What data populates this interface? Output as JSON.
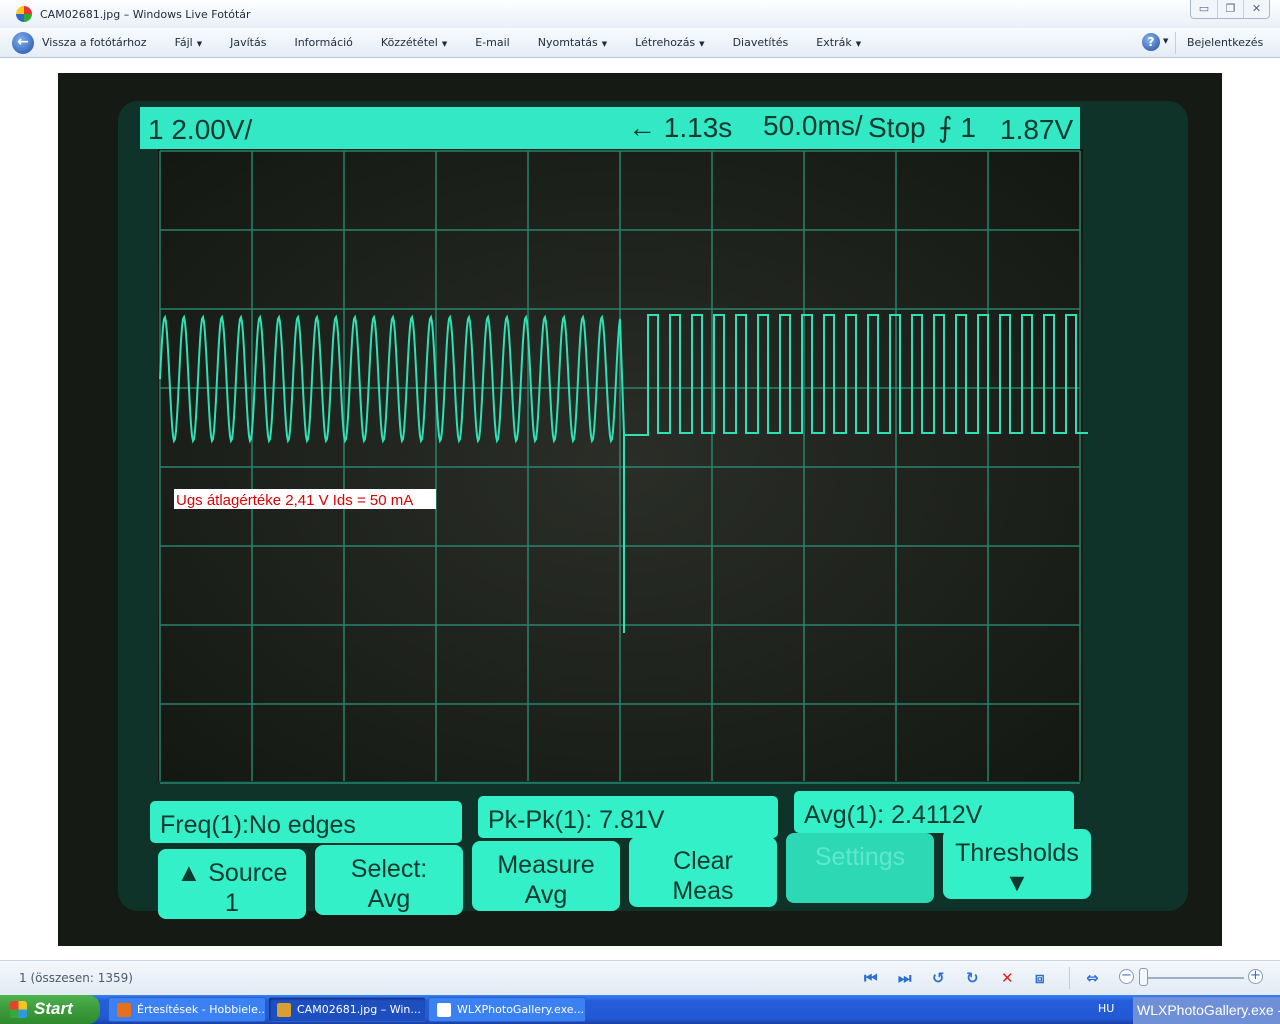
{
  "window": {
    "title": "CAM02681.jpg – Windows Live Fotótár",
    "controls": [
      "minimize",
      "restore",
      "close"
    ]
  },
  "toolbar": {
    "back_label": "Vissza a fotótárhoz",
    "items": [
      {
        "label": "Fájl",
        "dropdown": true
      },
      {
        "label": "Javítás",
        "dropdown": false
      },
      {
        "label": "Információ",
        "dropdown": false
      },
      {
        "label": "Közzététel",
        "dropdown": true
      },
      {
        "label": "E-mail",
        "dropdown": false
      },
      {
        "label": "Nyomtatás",
        "dropdown": true
      },
      {
        "label": "Létrehozás",
        "dropdown": true
      },
      {
        "label": "Diavetítés",
        "dropdown": false
      },
      {
        "label": "Extrák",
        "dropdown": true
      }
    ],
    "help_icon": "?",
    "signin_label": "Bejelentkezés"
  },
  "photo": {
    "scope": {
      "channel_scale": "1 2.00V/",
      "time_delay": "← 1.13s",
      "timebase": "50.0ms/",
      "run_state": "Stop",
      "trigger": "⨍ 1",
      "trigger_level": "1.87V",
      "measurements": [
        "Freq(1):No edges",
        "Pk-Pk(1): 7.81V",
        "Avg(1): 2.4112V"
      ],
      "softkeys": [
        {
          "line1": "▲ Source",
          "line2": "1"
        },
        {
          "line1": "Select:",
          "line2": "Avg"
        },
        {
          "line1": "Measure",
          "line2": "Avg"
        },
        {
          "line1": "Clear",
          "line2": "Meas"
        },
        {
          "line1": "Settings",
          "line2": ""
        },
        {
          "line1": "Thresholds",
          "line2": "▼"
        }
      ],
      "trace_color": "#2fe0b4",
      "panel_color": "#33f0c8"
    },
    "annotation": "Ugs átlagértéke 2,41 V   Ids = 50 mA",
    "annotation_color": "#e00000"
  },
  "statusbar": {
    "count": "1 (összesen: 1359)",
    "controls": [
      "previous-icon",
      "next-icon",
      "rotate-left-icon",
      "rotate-right-icon",
      "delete-icon",
      "slideshow-icon",
      "fit-icon"
    ],
    "zoom_level": 0.05
  },
  "taskbar": {
    "start_label": "Start",
    "tasks": [
      {
        "label": "Értesítések - Hobbiele...",
        "active": false
      },
      {
        "label": "CAM02681.jpg – Win...",
        "active": true
      },
      {
        "label": "WLXPhotoGallery.exe...",
        "active": false
      }
    ],
    "language": "HU",
    "tooltip": "WLXPhotoGallery.exe -"
  }
}
